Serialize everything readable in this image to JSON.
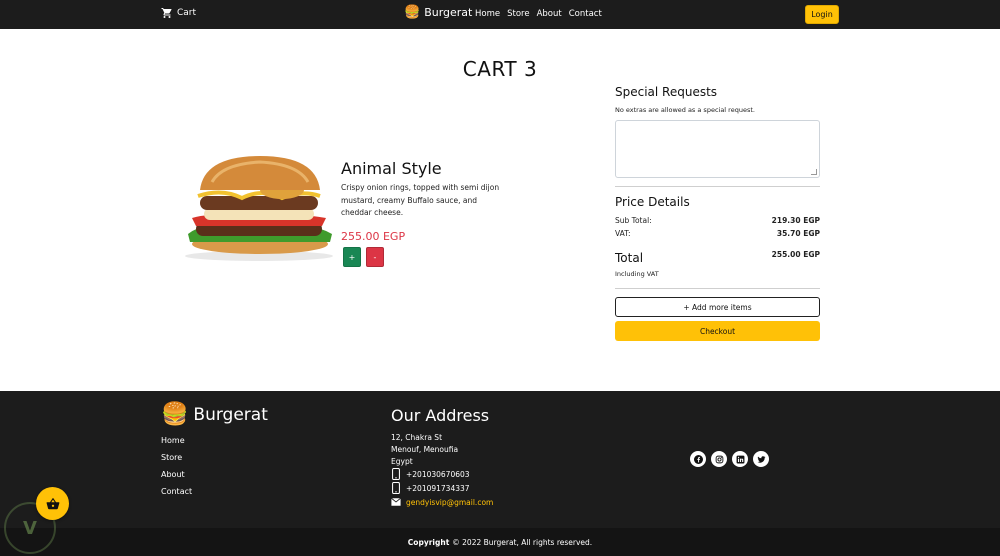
{
  "navbar": {
    "cart_label": "Cart",
    "brand": "Burgerat",
    "brand_icon": "🍔",
    "links": [
      "Home",
      "Store",
      "About",
      "Contact"
    ],
    "login_label": "Login"
  },
  "page": {
    "title": "CART 3"
  },
  "product": {
    "name": "Animal Style",
    "description": "Crispy onion rings, topped with semi dijon mustard, creamy Buffalo sauce, and cheddar cheese.",
    "price": "255.00 EGP",
    "plus_label": "+",
    "minus_label": "-"
  },
  "special_requests": {
    "title": "Special Requests",
    "note": "No extras are allowed as a special request.",
    "value": ""
  },
  "price_details": {
    "title": "Price Details",
    "sub_total_label": "Sub Total:",
    "sub_total_value": "219.30 EGP",
    "vat_label": "VAT:",
    "vat_value": "35.70 EGP",
    "total_label": "Total",
    "total_value": "255.00 EGP",
    "total_note": "Including VAT"
  },
  "actions": {
    "add_more_label": "+ Add more items",
    "checkout_label": "Checkout"
  },
  "footer": {
    "brand": "Burgerat",
    "brand_icon": "🍔",
    "links": [
      "Home",
      "Store",
      "About",
      "Contact"
    ],
    "address_title": "Our Address",
    "address_lines": [
      "12, Chakra St",
      "Menouf, Menoufia",
      "Egypt"
    ],
    "phone1": "+201030670603",
    "phone2": "+201091734337",
    "email": "gendyisvip@gmail.com",
    "socials": [
      "facebook-icon",
      "instagram-icon",
      "linkedin-icon",
      "twitter-icon"
    ],
    "copyright_bold": "Copyright",
    "copyright_rest": "© 2022 Burgerat, All rights reserved."
  },
  "colors": {
    "nav_bg": "#1c1c1c",
    "accent": "#ffc107",
    "price": "#dc3545",
    "plus": "#198754",
    "minus": "#dc3545"
  }
}
